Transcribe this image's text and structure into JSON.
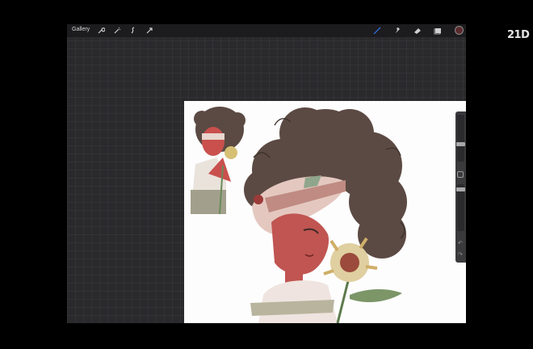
{
  "watermark": "21D",
  "toolbar": {
    "gallery_label": "Gallery",
    "left_tools": [
      "wrench-icon",
      "magic-wand-icon",
      "selection-icon",
      "transform-icon"
    ],
    "right_tools": [
      "brush-icon",
      "smudge-icon",
      "eraser-icon",
      "layers-icon"
    ],
    "current_color": "#5a2b2e"
  },
  "sidebar": {
    "controls": [
      "brush-size-slider",
      "modify-button",
      "opacity-slider",
      "undo-button",
      "redo-button"
    ]
  },
  "colors": {
    "app_bg": "#2a292c",
    "toolbar_bg": "#1c1b1d",
    "canvas_bg": "#fdfdfd",
    "accent_blue": "#2f6bd6"
  }
}
